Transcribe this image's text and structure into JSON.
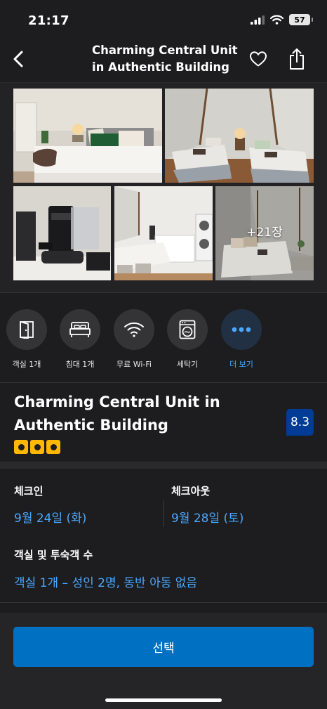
{
  "status_bar": {
    "time": "21:17",
    "battery": "57"
  },
  "nav": {
    "title": "Charming Central Unit in Authentic Building"
  },
  "gallery": {
    "more_photos": "+21장"
  },
  "amenities": [
    {
      "label": "객실 1개",
      "icon": "door-icon"
    },
    {
      "label": "침대 1개",
      "icon": "bed-icon"
    },
    {
      "label": "무료 Wi-Fi",
      "icon": "wifi-icon"
    },
    {
      "label": "세탁기",
      "icon": "washing-machine-icon"
    },
    {
      "label": "더 보기",
      "icon": "more-dots-icon"
    }
  ],
  "property": {
    "name": "Charming Central Unit in Authentic Building",
    "stars": 3,
    "rating": "8.3"
  },
  "booking": {
    "checkin_label": "체크인",
    "checkin_value": "9월 24일 (화)",
    "checkout_label": "체크아웃",
    "checkout_value": "9월 28일 (토)",
    "guests_label": "객실 및 투숙객 수",
    "guests_value": "객실 1개 – 성인 2명, 동반 아동 없음"
  },
  "actions": {
    "select_label": "선택"
  },
  "colors": {
    "accent": "#0071c2",
    "link": "#4aa8ff",
    "rating_bg": "#003b95",
    "star": "#ffb700",
    "background": "#1d1d1f"
  }
}
